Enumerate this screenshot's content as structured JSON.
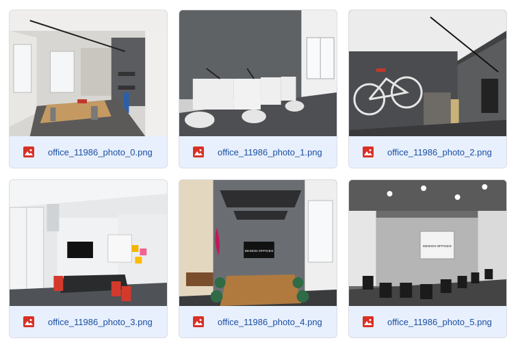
{
  "files": [
    {
      "name": "office_11986_photo_0.png",
      "icon": "image-file-icon",
      "scene": "meeting-table-bright-room"
    },
    {
      "name": "office_11986_photo_1.png",
      "icon": "image-file-icon",
      "scene": "desks-and-chairs"
    },
    {
      "name": "office_11986_photo_2.png",
      "icon": "image-file-icon",
      "scene": "bicycle-on-wall"
    },
    {
      "name": "office_11986_photo_3.png",
      "icon": "image-file-icon",
      "scene": "meeting-room-red-chairs"
    },
    {
      "name": "office_11986_photo_4.png",
      "icon": "image-file-icon",
      "scene": "conference-room-screen",
      "screen_text": "DESIGN OFFICES"
    },
    {
      "name": "office_11986_photo_5.png",
      "icon": "image-file-icon",
      "scene": "event-hall-rows-of-chairs",
      "screen_text": "DESIGN OFFICES"
    }
  ],
  "colors": {
    "card_bg": "#e8f0fe",
    "icon_red": "#d93025",
    "filename_blue": "#1a4fa0"
  }
}
